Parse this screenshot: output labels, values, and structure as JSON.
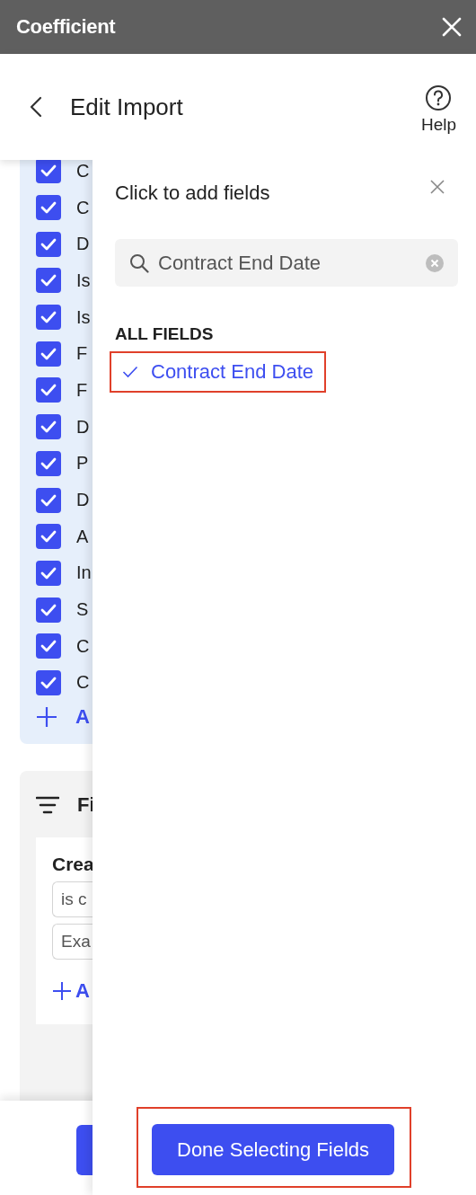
{
  "app_bar": {
    "title": "Coefficient"
  },
  "header": {
    "title": "Edit Import",
    "help_label": "Help"
  },
  "fields": [
    {
      "label": "C",
      "checked": true
    },
    {
      "label": "C",
      "checked": true
    },
    {
      "label": "D",
      "checked": true
    },
    {
      "label": "Is",
      "checked": true
    },
    {
      "label": "Is",
      "checked": true
    },
    {
      "label": "F",
      "checked": true
    },
    {
      "label": "F",
      "checked": true
    },
    {
      "label": "D",
      "checked": true
    },
    {
      "label": "P",
      "checked": true
    },
    {
      "label": "D",
      "checked": true
    },
    {
      "label": "A",
      "checked": true
    },
    {
      "label": "In",
      "checked": true
    },
    {
      "label": "S",
      "checked": true
    },
    {
      "label": "C",
      "checked": true
    },
    {
      "label": "C",
      "checked": true
    }
  ],
  "add_field_label": "A",
  "filters": {
    "title": "Fi",
    "condition": {
      "field": "Crea",
      "operator": "is c",
      "value": "Exa"
    },
    "add_label": "A"
  },
  "drawer": {
    "title": "Click to add fields",
    "search": {
      "value": "Contract End Date"
    },
    "section": "ALL FIELDS",
    "results": [
      {
        "label": "Contract End Date",
        "selected": true,
        "highlighted": true
      }
    ],
    "done_button": {
      "label": "Done Selecting Fields",
      "highlighted": true
    }
  }
}
